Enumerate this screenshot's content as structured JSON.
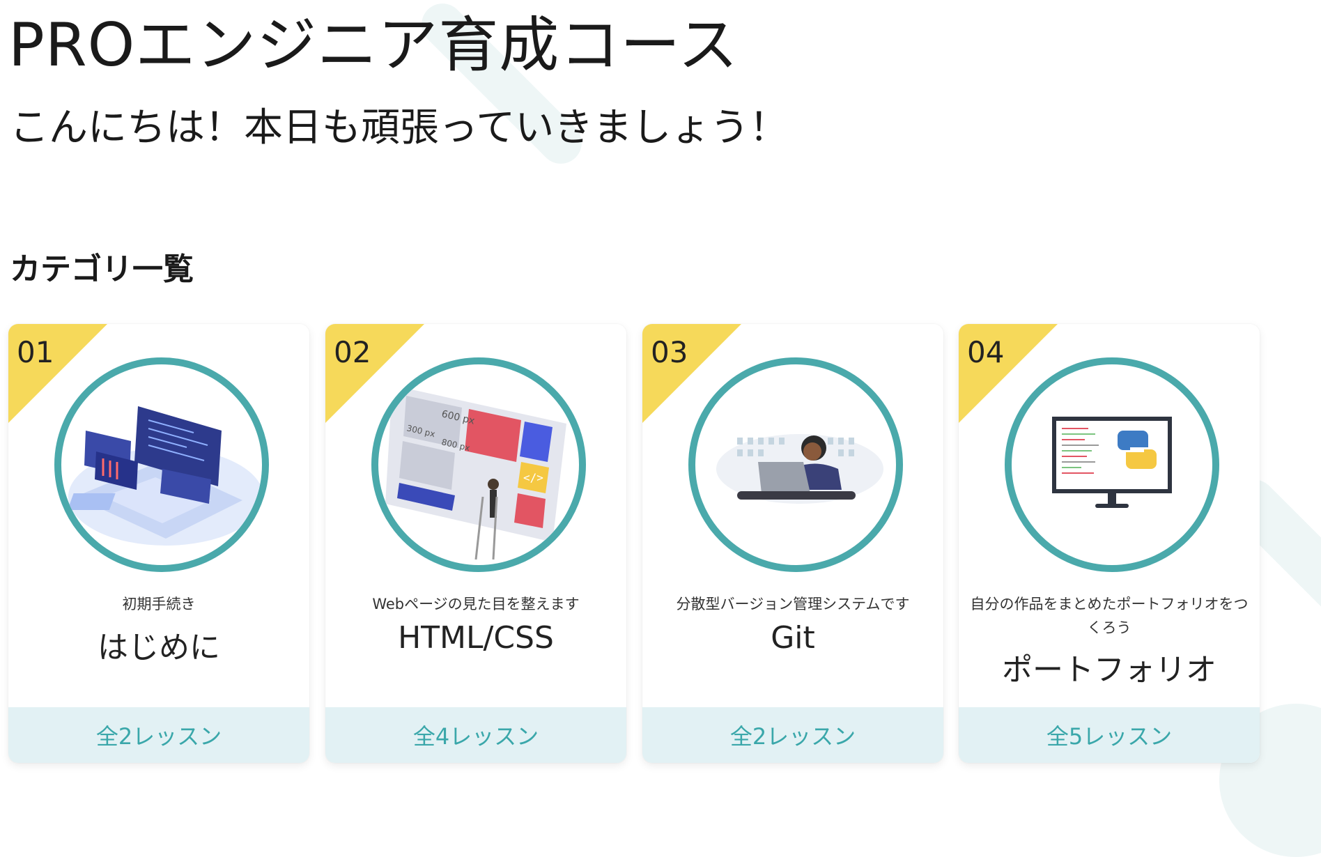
{
  "header": {
    "title": "PROエンジニア育成コース",
    "greeting": "こんにちは！本日も頑張っていきましょう！"
  },
  "section": {
    "title": "カテゴリ一覧"
  },
  "categories": [
    {
      "number": "01",
      "description": "初期手続き",
      "title": "はじめに",
      "lessons": "全2レッスン",
      "icon": "laptop-code-illustration"
    },
    {
      "number": "02",
      "description": "Webページの見た目を整えます",
      "title": "HTML/CSS",
      "lessons": "全4レッスン",
      "icon": "web-layout-illustration",
      "image_labels": [
        "600 px",
        "300 px",
        "800 px",
        "</>"
      ]
    },
    {
      "number": "03",
      "description": "分散型バージョン管理システムです",
      "title": "Git",
      "lessons": "全2レッスン",
      "icon": "person-laptop-illustration"
    },
    {
      "number": "04",
      "description": "自分の作品をまとめたポートフォリオをつくろう",
      "title": "ポートフォリオ",
      "lessons": "全5レッスン",
      "icon": "monitor-python-illustration"
    }
  ],
  "colors": {
    "ribbon": "#f6d95a",
    "circle_border": "#4aa9ab",
    "footer_bg": "#e2f1f4",
    "footer_text": "#3aa7aa"
  }
}
